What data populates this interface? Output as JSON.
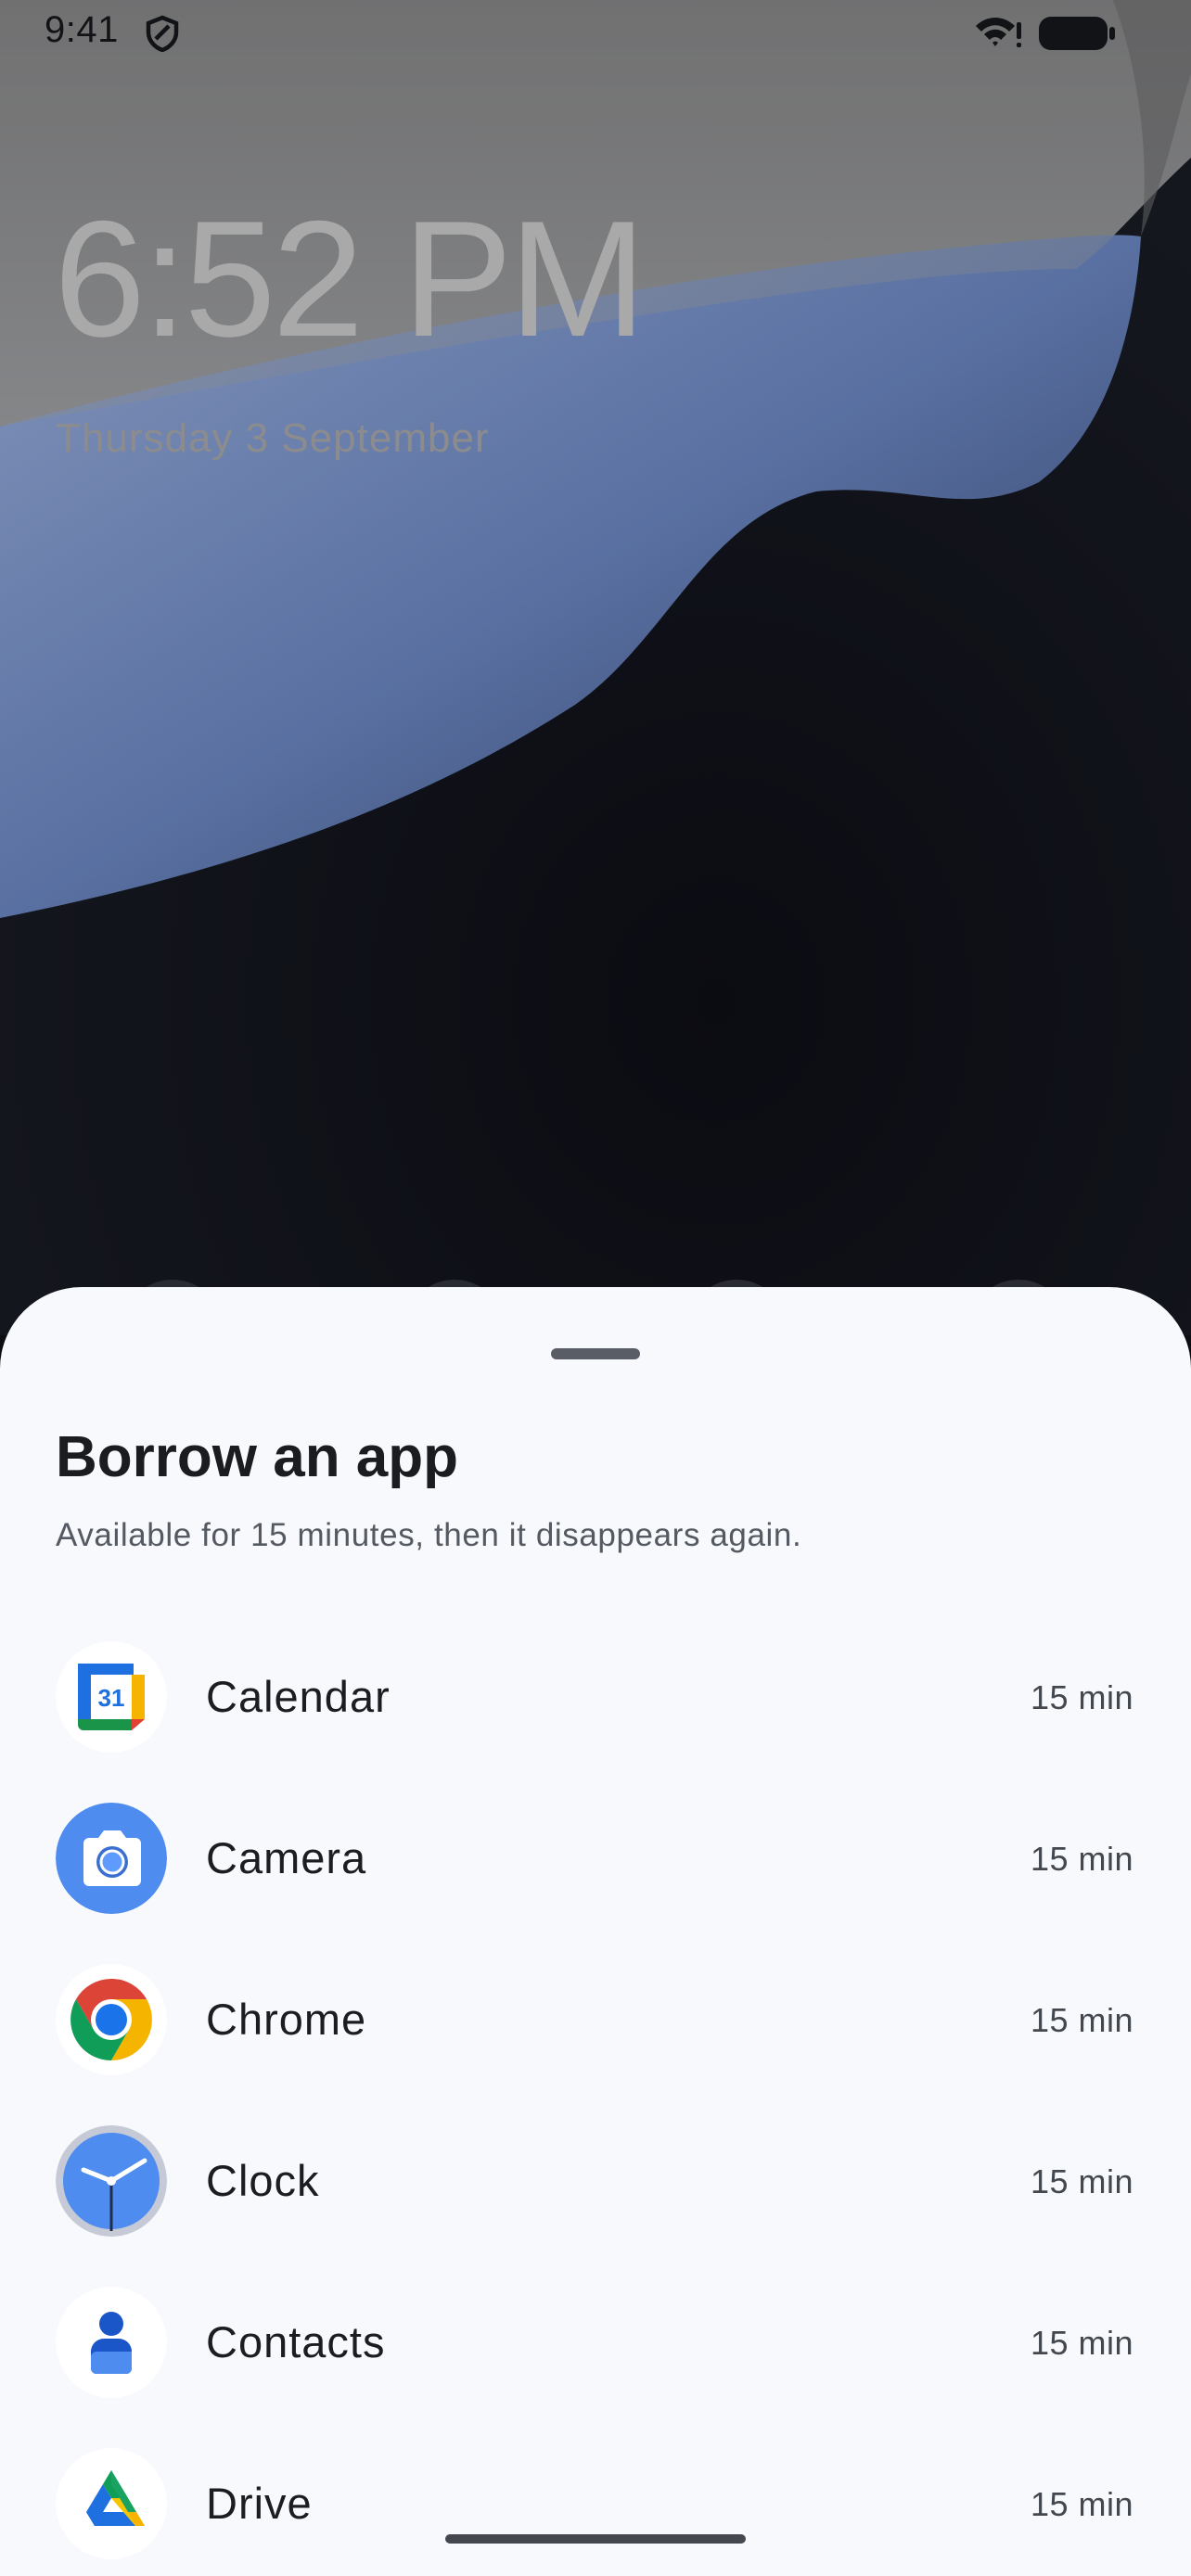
{
  "status_bar": {
    "time": "9:41",
    "icons": [
      "shield-icon",
      "wifi-alert-icon",
      "battery-icon"
    ]
  },
  "lock_screen": {
    "time": "6:52 PM",
    "date": "Thursday 3 September"
  },
  "sheet": {
    "title": "Borrow an app",
    "subtitle": "Available for 15 minutes, then it disappears again.",
    "apps": [
      {
        "name": "Calendar",
        "duration": "15 min",
        "icon": "calendar-icon",
        "icon_text": "31"
      },
      {
        "name": "Camera",
        "duration": "15 min",
        "icon": "camera-icon"
      },
      {
        "name": "Chrome",
        "duration": "15 min",
        "icon": "chrome-icon"
      },
      {
        "name": "Clock",
        "duration": "15 min",
        "icon": "clock-icon"
      },
      {
        "name": "Contacts",
        "duration": "15 min",
        "icon": "contacts-icon"
      },
      {
        "name": "Drive",
        "duration": "15 min",
        "icon": "drive-icon"
      }
    ]
  },
  "colors": {
    "sheet_background": "#f7f9fc",
    "wallpaper_blue": "#6e86b8",
    "wallpaper_dark": "#0d0e14",
    "overlay_gray": "#7a7a7a"
  }
}
